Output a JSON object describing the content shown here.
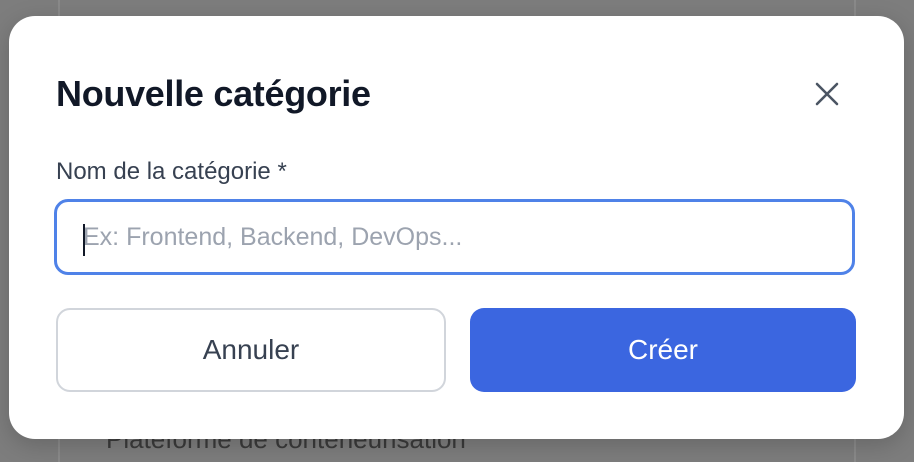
{
  "background": {
    "partial_text": "Plateforme de conteneurisation"
  },
  "dialog": {
    "title": "Nouvelle catégorie",
    "close_icon": "close-icon",
    "field": {
      "label": "Nom de la catégorie *",
      "value": "",
      "placeholder": "Ex: Frontend, Backend, DevOps..."
    },
    "buttons": {
      "cancel_label": "Annuler",
      "create_label": "Créer"
    }
  },
  "colors": {
    "accent": "#3b66e0",
    "focus_border": "#4f82e8",
    "title": "#111827",
    "overlay": "#808080"
  }
}
